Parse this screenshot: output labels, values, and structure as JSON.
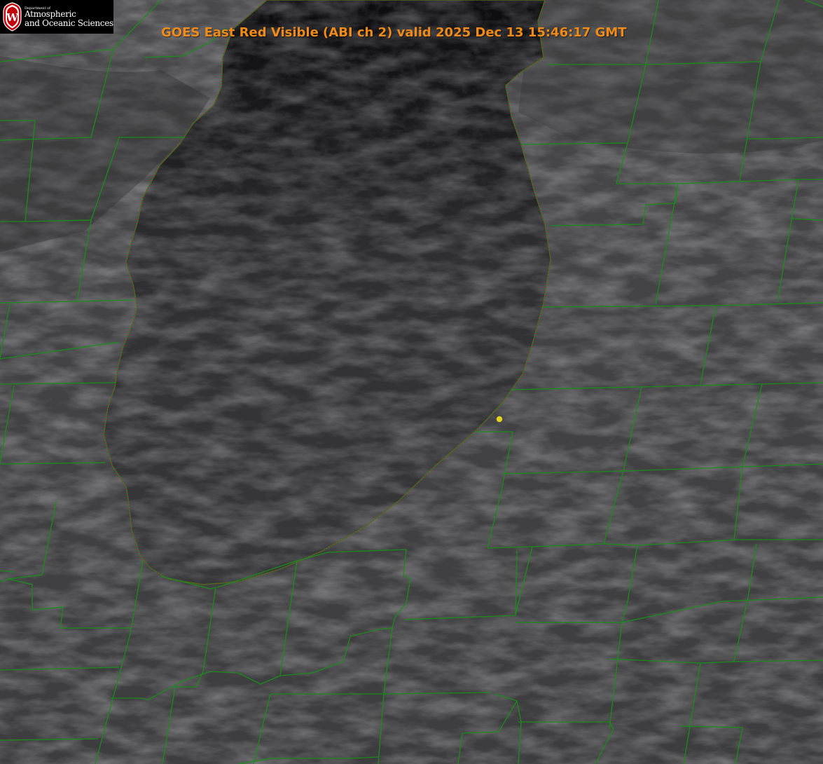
{
  "title": "GOES East Red Visible (ABI ch 2) valid 2025 Dec 13 15:46:17 GMT",
  "logo": {
    "department": "Department of",
    "line1": "Atmospheric",
    "line2": "and Oceanic Sciences",
    "crest_letter": "W"
  },
  "colors": {
    "title": "#f08a18",
    "county_lines": "#1a8c1a",
    "shoreline": "#c0202a",
    "marker": "#e6d21c",
    "logo_crest": "#c5050c"
  },
  "layers": [
    "county-boundaries",
    "lake-shoreline",
    "location-marker"
  ]
}
